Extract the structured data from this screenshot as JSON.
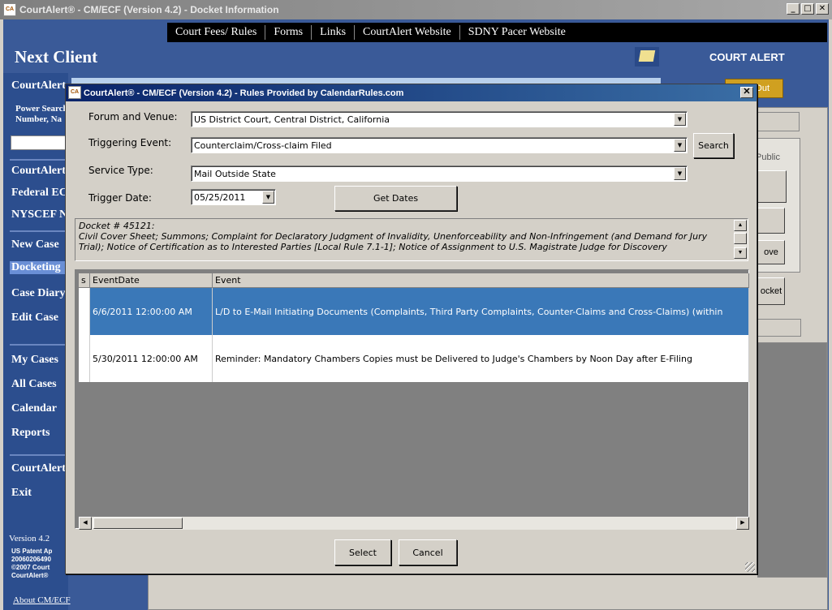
{
  "outer_window": {
    "title": "CourtAlert® - CM/ECF (Version 4.2) - Docket Information",
    "icon": "courtalert-app-icon",
    "minimize": "_",
    "maximize": "□",
    "close": "✕"
  },
  "top_menu": [
    "Court Fees/ Rules",
    "Forms",
    "Links",
    "CourtAlert Website",
    "SDNY Pacer Website"
  ],
  "header": {
    "next_client": "Next Client",
    "court_alert": "COURT ALERT"
  },
  "sidebar": {
    "courtalert_title": "CourtAlert",
    "power_search_1": "Power Search",
    "power_search_2": "Number, Na",
    "group1": [
      "CourtAlert",
      "Federal EC",
      "NYSCEF N"
    ],
    "group2": [
      "New Case",
      "Docketing",
      "Case Diary",
      "Edit Case"
    ],
    "group3": [
      "My Cases",
      "All Cases",
      "Calendar",
      "Reports"
    ],
    "group4": [
      "CourtAlert",
      "Exit"
    ],
    "version": "Version 4.2",
    "patent_1": "US Patent Ap",
    "patent_2": "20060206490",
    "patent_3": "©2007 Court",
    "patent_4": "CourtAlert®",
    "about": "About CM/ECF"
  },
  "background": {
    "out_button": "Out",
    "public_label": "Public",
    "remove_button": "ove",
    "docket_button": "ocket"
  },
  "dialog": {
    "title": "CourtAlert® - CM/ECF (Version 4.2) - Rules Provided by CalendarRules.com",
    "close": "✕",
    "forum_label": "Forum and Venue:",
    "forum_value": "US District Court, Central District, California",
    "trigger_label": "Triggering Event:",
    "trigger_value": "Counterclaim/Cross-claim Filed",
    "search_button": "Search",
    "service_label": "Service Type:",
    "service_value": "Mail Outside State",
    "date_label": "Trigger Date:",
    "date_value": "05/25/2011",
    "get_dates_button": "Get Dates",
    "docket_text": "Docket # 45121:\nCivil Cover Sheet; Summons; Complaint for Declaratory Judgment of Invalidity, Unenforceability and Non-Infringement (and Demand for Jury Trial); Notice of Certification as to Interested Parties [Local Rule 7.1-1]; Notice of Assignment to U.S. Magistrate Judge for Discovery",
    "grid": {
      "columns": [
        "s",
        "EventDate",
        "Event"
      ],
      "rows": [
        {
          "s": "",
          "date": "6/6/2011 12:00:00 AM",
          "event": "L/D to E-Mail Initiating Documents (Complaints, Third Party Complaints, Counter-Claims and Cross-Claims) (within",
          "selected": true
        },
        {
          "s": "",
          "date": "5/30/2011 12:00:00 AM",
          "event": "Reminder: Mandatory Chambers Copies must be Delivered to Judge's Chambers by Noon Day after E-Filing",
          "selected": false
        }
      ]
    },
    "select_button": "Select",
    "cancel_button": "Cancel"
  },
  "colors": {
    "dialog_title_start": "#0a246a",
    "dialog_title_end": "#3a6ea5",
    "selected_row": "#3a78b8",
    "app_background": "#3a5a98"
  }
}
